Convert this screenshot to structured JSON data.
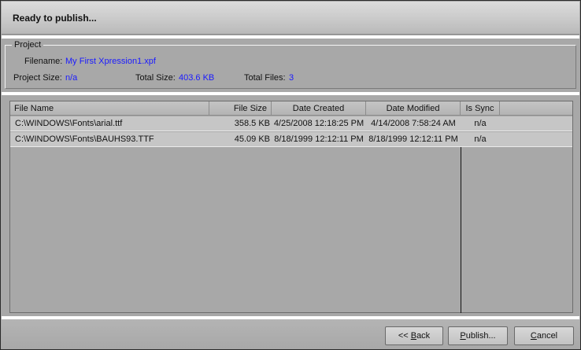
{
  "header": {
    "title": "Ready to publish..."
  },
  "project": {
    "group_label": "Project",
    "filename_label": "Filename:",
    "filename_value": "My First Xpression1.xpf",
    "project_size_label": "Project Size:",
    "project_size_value": "n/a",
    "total_size_label": "Total Size:",
    "total_size_value": "403.6 KB",
    "total_files_label": "Total Files:",
    "total_files_value": "3"
  },
  "table": {
    "columns": [
      "File Name",
      "File Size",
      "Date Created",
      "Date Modified",
      "Is Sync"
    ],
    "rows": [
      [
        "C:\\WINDOWS\\Fonts\\arial.ttf",
        "358.5 KB",
        "4/25/2008 12:18:25 PM",
        "4/14/2008 7:58:24 AM",
        "n/a"
      ],
      [
        "C:\\WINDOWS\\Fonts\\BAUHS93.TTF",
        "45.09 KB",
        "8/18/1999 12:12:11 PM",
        "8/18/1999 12:12:11 PM",
        "n/a"
      ]
    ]
  },
  "buttons": {
    "back_prefix": "<< ",
    "back_mnemonic": "B",
    "back_rest": "ack",
    "publish_mnemonic": "P",
    "publish_rest": "ublish...",
    "cancel_mnemonic": "C",
    "cancel_rest": "ancel"
  }
}
